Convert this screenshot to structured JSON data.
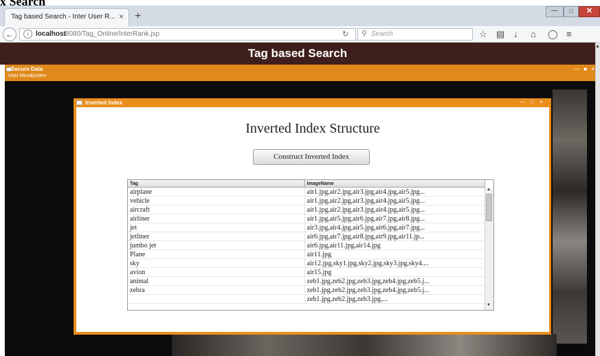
{
  "page_heading_cropped": "x Search",
  "browser": {
    "tab_title": "Tag based Search - Inter User R...",
    "tab_close": "×",
    "new_tab": "+",
    "url_host": "localhost",
    "url_rest": ":8080/Tag_Online/InterRank.jsp",
    "search_placeholder": "Search",
    "window_controls": {
      "min": "—",
      "max": "□",
      "close": "✕"
    },
    "icons": [
      "back-arrow-icon",
      "info-icon",
      "reload-icon",
      "search-icon",
      "bookmark-star-icon",
      "reader-icon",
      "download-icon",
      "home-icon",
      "pocket-icon",
      "menu-icon"
    ]
  },
  "header": {
    "title": "Tag based Search"
  },
  "app": {
    "title": "Secure Data",
    "menu": [
      "User Menu",
      "System"
    ],
    "controls": "— ■ ×"
  },
  "dialog": {
    "title": "Inverted Index",
    "controls": "— □ ×",
    "heading": "Inverted Index Structure",
    "button_label": "Construct Inverted Index",
    "table": {
      "columns": [
        "Tag",
        "ImageName"
      ],
      "rows": [
        [
          "airplane",
          "air1.jpg,air2.jpg,air3.jpg,air4.jpg,air5.jpg..."
        ],
        [
          "vehicle",
          "air1.jpg,air2.jpg,air3.jpg,air4.jpg,air5.jpg..."
        ],
        [
          "aircraft",
          "air1.jpg,air2.jpg,air3.jpg,air4.jpg,air5.jpg..."
        ],
        [
          "airliner",
          "air1.jpg,air5.jpg,air6.jpg,air7.jpg,air8.jpg..."
        ],
        [
          "jet",
          "air3.jpg,air4.jpg,air5.jpg,air6.jpg,air7.jpg..."
        ],
        [
          "jetliner",
          "air6.jpg,air7.jpg,air8.jpg,air9.jpg,air11.jp..."
        ],
        [
          "jumbo jet",
          "air6.jpg,air11.jpg,air14.jpg"
        ],
        [
          "Plane",
          "air11.jpg"
        ],
        [
          "sky",
          "air12.jpg,sky1.jpg,sky2.jpg,sky3.jpg,sky4...."
        ],
        [
          "avion",
          "air15.jpg"
        ],
        [
          "animal",
          "zeb1.jpg,zeb2.jpg,zeb3.jpg,zeb4.jpg,zeb5.j..."
        ],
        [
          "zebra",
          "zeb1.jpg,zeb2.jpg,zeb3.jpg,zeb4.jpg,zeb5.j..."
        ],
        [
          "",
          "zeb1.jpg,zeb2.jpg,zeb3.jpg,..."
        ]
      ]
    }
  },
  "colors": {
    "header_bg": "#3f1f1b",
    "app_accent": "#e08a1c",
    "dialog_accent": "#e98d1c"
  }
}
